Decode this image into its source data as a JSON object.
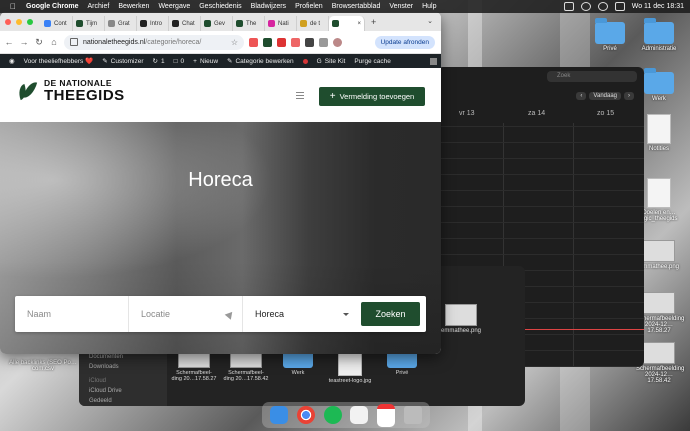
{
  "menubar": {
    "app_name": "Google Chrome",
    "items": [
      "Archief",
      "Bewerken",
      "Weergave",
      "Geschiedenis",
      "Bladwijzers",
      "Profielen",
      "Browsertabblad",
      "Venster",
      "Hulp"
    ],
    "clock": "Wo 11 dec  18:31"
  },
  "desktop_icons": [
    {
      "label": "Privé"
    },
    {
      "label": "Administratie"
    },
    {
      "label": "Werk"
    },
    {
      "label": "Notities"
    },
    {
      "label": "Doelen en…ogic_theegids"
    },
    {
      "label": "emmathee.png"
    },
    {
      "label": "Schermafbeelding\n2024-12…17.58.27"
    },
    {
      "label": "Schermafbeelding\n2024-12…17.58.42"
    }
  ],
  "desktop_left_file": {
    "label": "Alle backlinks\n(SEO Po…com.csv"
  },
  "calendar": {
    "search_placeholder": "Zoek",
    "today_label": "Vandaag",
    "days": [
      "vr 13",
      "za 14",
      "zo 15"
    ]
  },
  "finder": {
    "sidebar": [
      "Documenten",
      "Downloads"
    ],
    "icloud_header": "iCloud",
    "icloud_items": [
      "iCloud Drive",
      "Gedeeld"
    ],
    "files": [
      "Schermafbeel-\nding 20…17.58.27",
      "Schermafbeel-\nding 20…17.58.42",
      "Werk",
      "teastreet-logo.jpg",
      "Privé"
    ],
    "top_file": "emmathee.png"
  },
  "browser": {
    "tabs": [
      {
        "label": "Cont",
        "color": "#3b82f6"
      },
      {
        "label": "Tijm",
        "color": "#1f4d2e"
      },
      {
        "label": "Grat",
        "color": "#888888"
      },
      {
        "label": "Intro",
        "color": "#222222"
      },
      {
        "label": "Chat",
        "color": "#222222"
      },
      {
        "label": "Gev",
        "color": "#1f4d2e"
      },
      {
        "label": "The",
        "color": "#1f4d2e"
      },
      {
        "label": "Nati",
        "color": "#d6249f"
      },
      {
        "label": "de t",
        "color": "#d0a020"
      },
      {
        "label": "",
        "color": "#1f4d2e",
        "active": true
      }
    ],
    "url_host": "nationaletheegids.nl",
    "url_path": "/categorie/horeca/",
    "update_label": "Update afronden",
    "wp_admin": {
      "site": "Voor theeliefhebbers ❤️",
      "customizer": "Customizer",
      "updates": "1",
      "comments": "0",
      "new": "Nieuw",
      "edit_category": "Categorie bewerken",
      "site_kit": "Site Kit",
      "purge": "Purge cache"
    }
  },
  "site": {
    "logo_line1": "DE NATIONALE",
    "logo_line2": "THEEGIDS",
    "add_listing": "Vermelding toevoegen",
    "hero_title": "Horeca",
    "search": {
      "name_placeholder": "Naam",
      "location_placeholder": "Locatie",
      "category_value": "Horeca",
      "button": "Zoeken"
    }
  },
  "colors": {
    "brand_green": "#1f4d2e",
    "wp_bar": "#1d2327",
    "update_chip": "#d3e3fd"
  }
}
